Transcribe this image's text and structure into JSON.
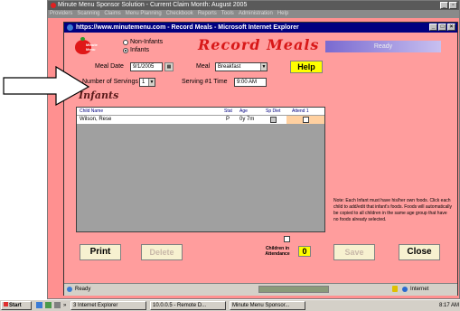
{
  "outer_window": {
    "title": "Minute Menu Sponsor Solution - Current Claim Month: August 2005",
    "menu": [
      "Providers",
      "Scanning",
      "Claims",
      "Menu Planning",
      "Checkbook",
      "Reports",
      "Tools",
      "Administration",
      "Help"
    ]
  },
  "ie_window": {
    "title": "https://www.minutemenu.com - Record Meals - Microsoft Internet Explorer"
  },
  "page": {
    "logo_text": "Minute Menu",
    "radio_non_infants": "Non-Infants",
    "radio_infants": "Infants",
    "heading": "Record Meals",
    "status_banner": "Ready",
    "meal_date_label": "Meal Date",
    "meal_date_value": "9/1/2005",
    "meal_label": "Meal",
    "meal_value": "Breakfast",
    "help_button": "Help",
    "servings_label": "Number of Servings",
    "servings_value": "1",
    "serving_time_label": "Serving #1 Time",
    "serving_time_value": "9:00 AM",
    "section_title": "Infants",
    "table": {
      "headers": [
        "Child Name",
        "Stat",
        "Age",
        "Sp Diet",
        "Attend 1"
      ],
      "rows": [
        {
          "name": "Wilson, Rese",
          "stat": "P",
          "age": "0y 7m"
        }
      ]
    },
    "note": "Note: Each Infant must have his/her own foods. Click each child to add/edit that infant's foods. Foods will automatically be copied to all children in the same age group that have no foods already selected.",
    "children_label": "Children in Attendance",
    "children_count": "0",
    "print_button": "Print",
    "delete_button": "Delete",
    "save_button": "Save",
    "close_button": "Close"
  },
  "statusbar": {
    "left": "Ready",
    "zone": "Internet"
  },
  "taskbar": {
    "start": "Start",
    "items": [
      "3 Internet Explorer",
      "10.0.0.5 - Remote D...",
      "Minute Menu Sponsor..."
    ],
    "clock": "8:17 AM"
  },
  "colors": {
    "page_bg": "#ff9d9d",
    "ie_title_bg": "#000080",
    "heading": "#d81818",
    "help_bg": "#ffff00",
    "children_count_bg": "#ffff00"
  }
}
